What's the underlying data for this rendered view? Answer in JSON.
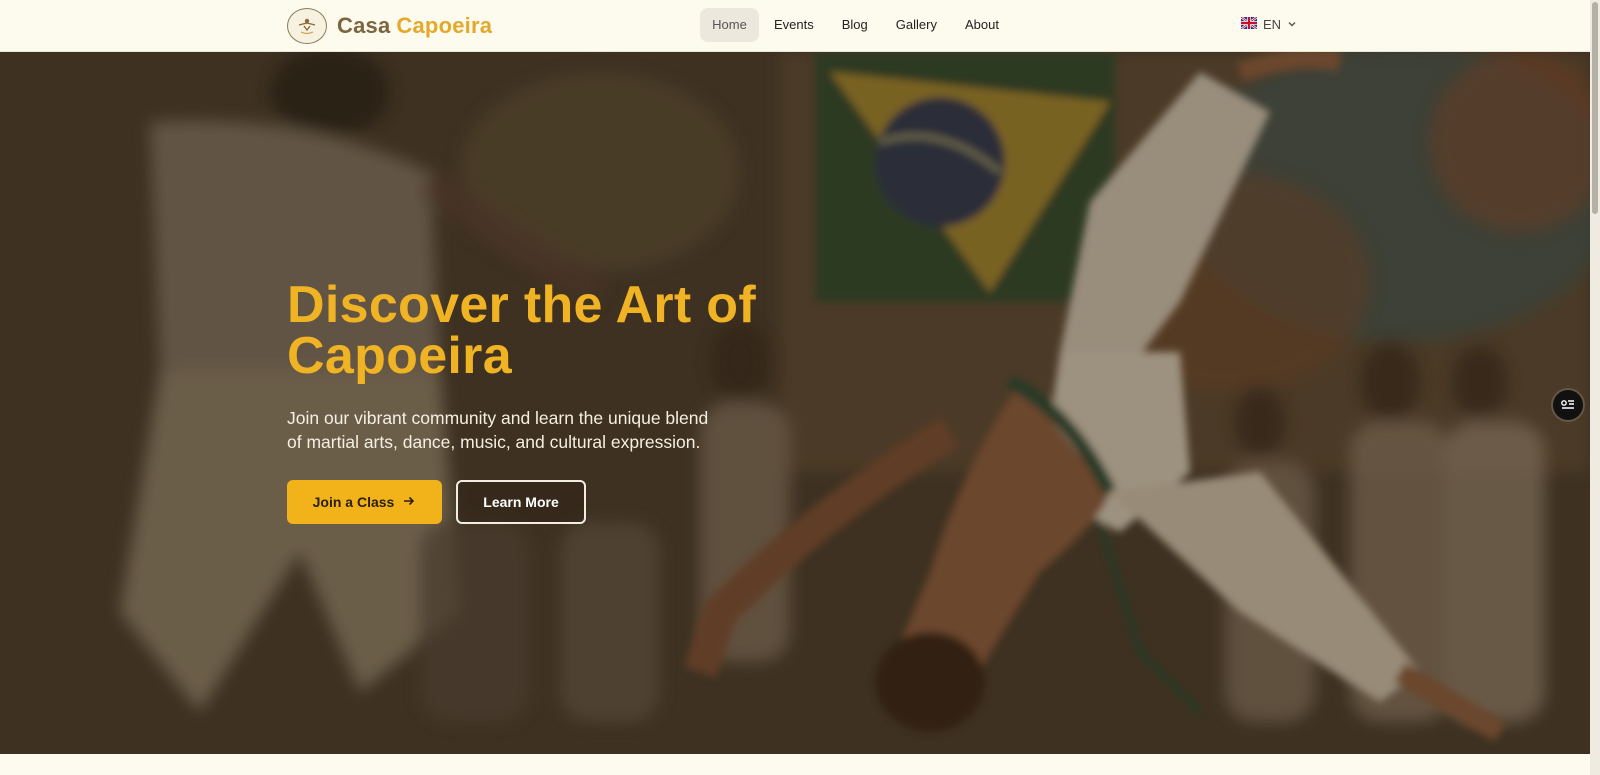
{
  "brand": {
    "word1": "Casa",
    "word2": "Capoeira"
  },
  "nav": {
    "items": [
      {
        "label": "Home",
        "active": true
      },
      {
        "label": "Events"
      },
      {
        "label": "Blog"
      },
      {
        "label": "Gallery"
      },
      {
        "label": "About"
      }
    ]
  },
  "language": {
    "code": "EN",
    "flag": "uk-flag-icon"
  },
  "hero": {
    "title_line1": "Discover the Art of",
    "title_line2": "Capoeira",
    "subtitle": "Join our vibrant community and learn the unique blend of martial arts, dance, music, and cultural expression.",
    "primary_cta": "Join a Class",
    "secondary_cta": "Learn More",
    "image_alt": "Capoeira players in a roda under a Brazilian flag"
  },
  "colors": {
    "accent": "#f2b21a",
    "title": "#f0b323",
    "page_bg": "#fdfaee",
    "brand_dark": "#7a6540"
  }
}
